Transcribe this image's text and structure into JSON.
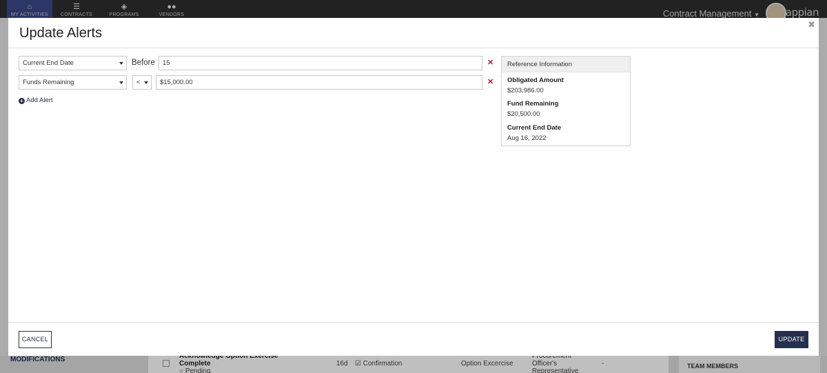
{
  "nav": {
    "tabs": [
      {
        "label": "MY ACTIVITIES",
        "icon": "home-icon"
      },
      {
        "label": "CONTRACTS",
        "icon": "list-icon"
      },
      {
        "label": "PROGRAMS",
        "icon": "tag-icon"
      },
      {
        "label": "VENDORS",
        "icon": "users-icon"
      }
    ],
    "app_name": "Contract Management",
    "brand": "appian"
  },
  "background": {
    "section_label": "MODIFICATIONS",
    "row_title": "Acknowledge Option Exercise",
    "row_title_2": "Complete",
    "row_status": "Pending",
    "row_due": "16d",
    "row_type": "Confirmation",
    "row_category": "Option Excercise",
    "row_role": "Procurement",
    "row_role_2": "Officer's",
    "row_role_3": "Representative",
    "row_dash": "-",
    "team_label": "TEAM MEMBERS"
  },
  "modal": {
    "title": "Update Alerts",
    "alerts": [
      {
        "field": "Current End Date",
        "operator": "Before",
        "value": "15"
      },
      {
        "field": "Funds Remaining",
        "operator": "<",
        "value": "$15,000.00"
      }
    ],
    "add_alert_label": "Add Alert",
    "reference": {
      "header": "Reference Information",
      "items": [
        {
          "label": "Obligated Amount",
          "value": "$203,986.00"
        },
        {
          "label": "Fund Remaining",
          "value": "$20,500.00"
        },
        {
          "label": "Current End Date",
          "value": "Aug 16, 2022"
        }
      ]
    },
    "cancel_label": "CANCEL",
    "update_label": "UPDATE"
  },
  "colors": {
    "accent": "#25304e",
    "remove": "#c8102e",
    "nav_active": "#3c4a8a"
  }
}
